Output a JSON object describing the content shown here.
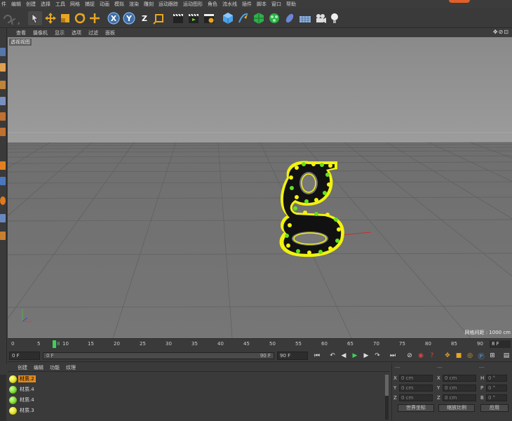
{
  "menu": [
    "件",
    "编辑",
    "创建",
    "选择",
    "工具",
    "网格",
    "捕捉",
    "动画",
    "模拟",
    "渲染",
    "雕刻",
    "运动跟踪",
    "运动图形",
    "角色",
    "流水线",
    "插件",
    "脚本",
    "窗口",
    "帮助"
  ],
  "toolbar": {
    "axis_x": "X",
    "axis_y": "Y",
    "axis_z": "Z"
  },
  "viewport": {
    "tabs": [
      "查看",
      "摄像机",
      "显示",
      "选项",
      "过滤",
      "面板"
    ],
    "nav_icons": "✥⊘⊡",
    "label": "透视视图",
    "grid_scale": "网格间距 : 1000 cm"
  },
  "timeline": {
    "ticks": [
      "0",
      "5",
      "10",
      "15",
      "20",
      "25",
      "30",
      "35",
      "40",
      "45",
      "50",
      "55",
      "60",
      "65",
      "70",
      "75",
      "80",
      "85",
      "90"
    ],
    "current_frame": "8",
    "frame_display": "8 F"
  },
  "transport": {
    "start": "0 F",
    "slider_left": "0 F",
    "slider_right": "90 F",
    "end": "90 F"
  },
  "materials": {
    "menu": [
      "创建",
      "编辑",
      "功能",
      "纹理"
    ],
    "items": [
      {
        "name": "材质.2",
        "color": "#e0e020",
        "selected": true
      },
      {
        "name": "材质.4",
        "color": "#7bd82a",
        "selected": false
      },
      {
        "name": "材质.4",
        "color": "#7bd82a",
        "selected": false
      },
      {
        "name": "材质.3",
        "color": "#e0e020",
        "selected": false
      }
    ]
  },
  "attributes": {
    "header_left": "---",
    "header_mid": "---",
    "header_right": "---",
    "rows": [
      {
        "l1": "X",
        "v1": "0 cm",
        "l2": "X",
        "v2": "0 cm",
        "l3": "H",
        "v3": "0 °"
      },
      {
        "l1": "Y",
        "v1": "0 cm",
        "l2": "Y",
        "v2": "0 cm",
        "l3": "P",
        "v3": "0 °"
      },
      {
        "l1": "Z",
        "v1": "0 cm",
        "l2": "Z",
        "v2": "0 cm",
        "l3": "B",
        "v3": "0 °"
      }
    ],
    "coord_mode": "世界坐标",
    "scale_mode": "缩放比例",
    "apply": "应用"
  },
  "colors": {
    "marquee_yellow": "#f2f20f",
    "bulb_green": "#62e21b",
    "letter_fill": "#111111",
    "accent_orange": "#e08a1e"
  }
}
